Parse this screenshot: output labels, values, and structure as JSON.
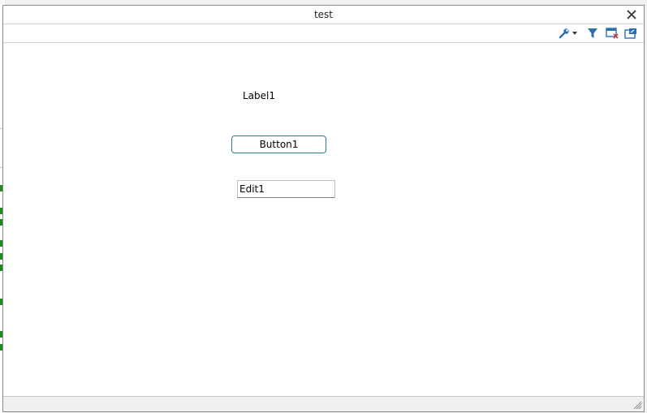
{
  "window": {
    "title": "test"
  },
  "toolbar": {
    "icons": [
      "wrench-icon",
      "filter-icon",
      "window-close-icon",
      "export-window-icon"
    ]
  },
  "form": {
    "label1": "Label1",
    "button1": "Button1",
    "edit1_value": "Edit1"
  },
  "colors": {
    "accent": "#2a6fb0",
    "button_border": "#2a7a8e",
    "close_x": "#d03030"
  }
}
